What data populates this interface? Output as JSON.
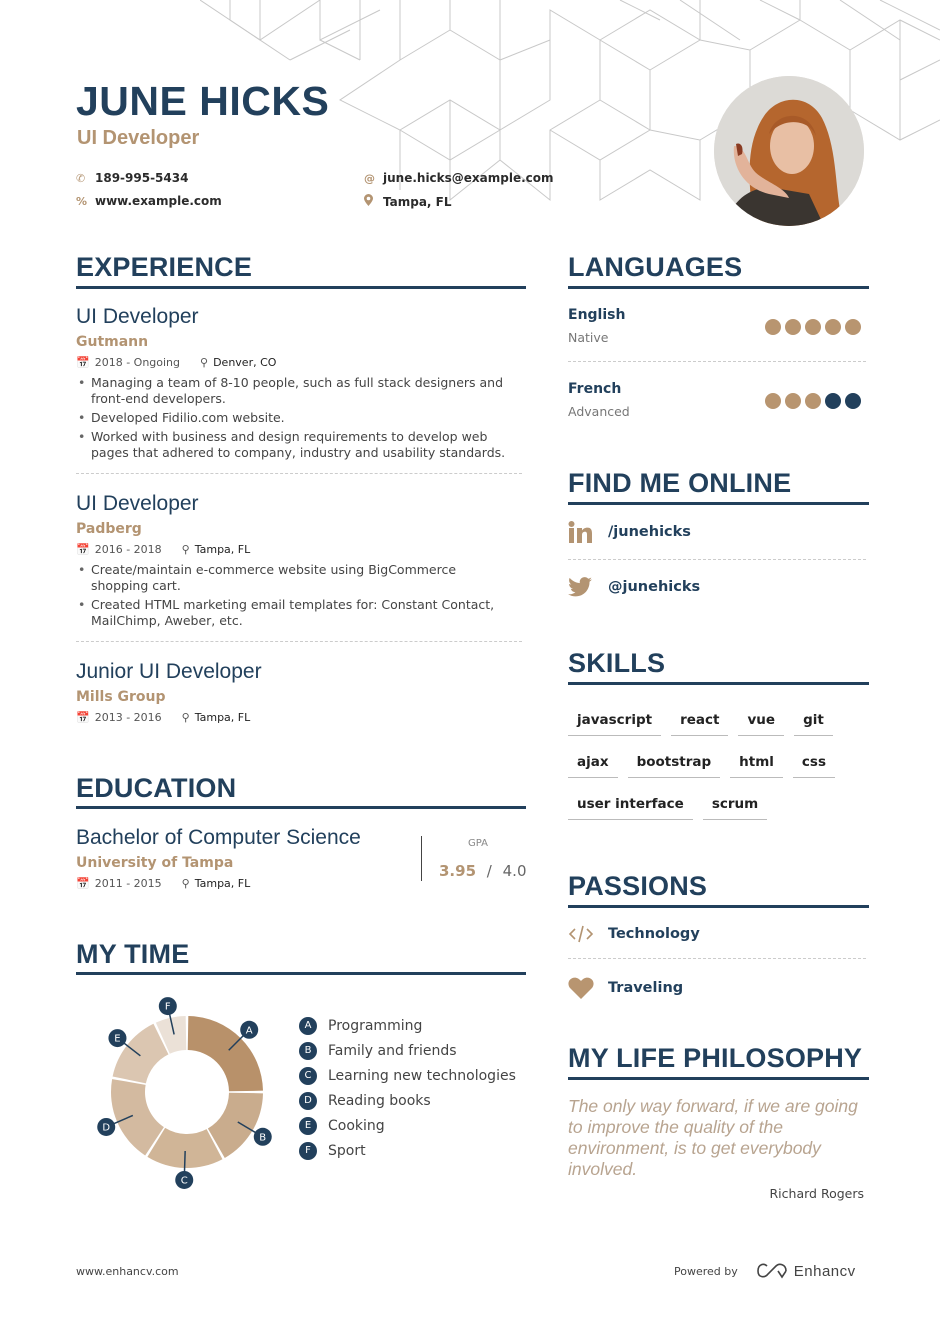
{
  "header": {
    "name": "JUNE HICKS",
    "role": "UI Developer",
    "contacts": {
      "phone": "189-995-5434",
      "website": "www.example.com",
      "email": "june.hicks@example.com",
      "location": "Tampa, FL"
    },
    "photo_alt": "Profile photo of June Hicks"
  },
  "colors": {
    "primary": "#22405c",
    "accent": "#b39472",
    "muted": "#777777"
  },
  "experience": {
    "title": "EXPERIENCE",
    "items": [
      {
        "role": "UI Developer",
        "company": "Gutmann",
        "dates": "2018 - Ongoing",
        "location": "Denver, CO",
        "bullets": [
          "Managing a team of 8-10 people, such as full stack designers and front-end developers.",
          "Developed Fidilio.com website.",
          "Worked with business and design requirements to develop web pages that adhered to company, industry and usability standards."
        ]
      },
      {
        "role": "UI Developer",
        "company": "Padberg",
        "dates": "2016 - 2018",
        "location": "Tampa, FL",
        "bullets": [
          "Create/maintain e-commerce website using BigCommerce shopping cart.",
          "Created HTML marketing email templates for: Constant Contact, MailChimp, Aweber, etc."
        ]
      },
      {
        "role": "Junior UI Developer",
        "company": "Mills Group",
        "dates": "2013 - 2016",
        "location": "Tampa, FL",
        "bullets": []
      }
    ]
  },
  "education": {
    "title": "EDUCATION",
    "degree": "Bachelor of Computer Science",
    "school": "University of Tampa",
    "dates": "2011 - 2015",
    "location": "Tampa, FL",
    "gpa_label": "GPA",
    "gpa": "3.95",
    "gpa_sep": "/",
    "gpa_max": "4.0"
  },
  "my_time": {
    "title": "MY TIME"
  },
  "chart_data": {
    "type": "pie",
    "title": "MY TIME",
    "donut": true,
    "categories": [
      "A",
      "B",
      "C",
      "D",
      "E",
      "F"
    ],
    "labels": [
      "Programming",
      "Family and friends",
      "Learning new technologies",
      "Reading books",
      "Cooking",
      "Sport"
    ],
    "values": [
      25,
      17,
      17,
      19,
      15,
      7
    ],
    "colors": [
      "#b8916a",
      "#c9ac8d",
      "#d0b597",
      "#d3baa0",
      "#dbc6b1",
      "#ebe1d7"
    ],
    "legend": "right"
  },
  "languages": {
    "title": "LANGUAGES",
    "items": [
      {
        "name": "English",
        "level": "Native",
        "rating": 5,
        "max": 5
      },
      {
        "name": "French",
        "level": "Advanced",
        "rating": 3,
        "max": 5
      }
    ]
  },
  "online": {
    "title": "FIND ME ONLINE",
    "items": [
      {
        "icon": "linkedin-icon",
        "label": "/junehicks"
      },
      {
        "icon": "twitter-icon",
        "label": "@junehicks"
      }
    ]
  },
  "skills": {
    "title": "SKILLS",
    "items": [
      "javascript",
      "react",
      "vue",
      "git",
      "ajax",
      "bootstrap",
      "html",
      "css",
      "user interface",
      "scrum"
    ]
  },
  "passions": {
    "title": "PASSIONS",
    "items": [
      {
        "icon": "code-icon",
        "label": "Technology"
      },
      {
        "icon": "heart-icon",
        "label": "Traveling"
      }
    ]
  },
  "philosophy": {
    "title": "MY LIFE PHILOSOPHY",
    "quote": "The only way forward, if we are going to improve the quality of the environment, is to get everybody involved.",
    "author": "Richard Rogers"
  },
  "footer": {
    "site": "www.enhancv.com",
    "powered_by": "Powered by",
    "brand": "Enhancv"
  }
}
